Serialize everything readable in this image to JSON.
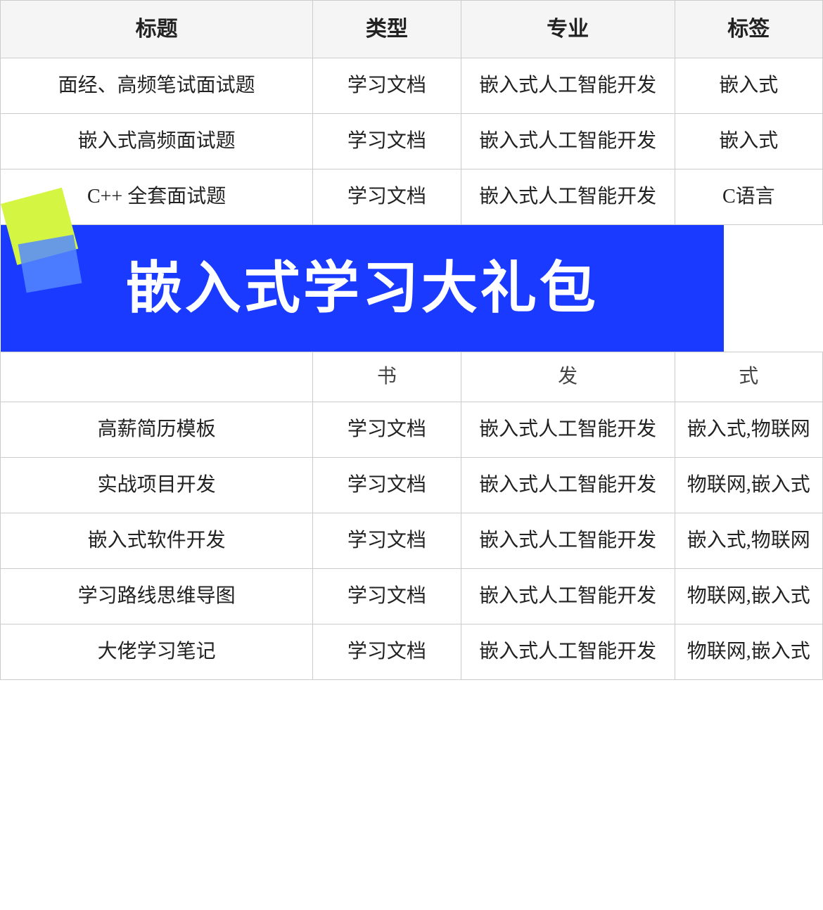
{
  "table": {
    "headers": [
      "标题",
      "类型",
      "专业",
      "标签"
    ],
    "rows": [
      {
        "title": "面经、高频笔试面试题",
        "type": "学习文档",
        "specialty": "嵌入式人工智能开发",
        "tag": "嵌入式"
      },
      {
        "title": "嵌入式高频面试题",
        "type": "学习文档",
        "specialty": "嵌入式人工智能开发",
        "tag": "嵌入式"
      },
      {
        "title": "C++ 全套面试题",
        "type": "学习文档",
        "specialty": "嵌入式人工智能开发",
        "tag": "C语言"
      }
    ],
    "partial_row": {
      "type": "书",
      "specialty": "发",
      "tag": "式"
    },
    "bottom_rows": [
      {
        "title": "高薪简历模板",
        "type": "学习文档",
        "specialty": "嵌入式人工智能开发",
        "tag": "嵌入式,物联网"
      },
      {
        "title": "实战项目开发",
        "type": "学习文档",
        "specialty": "嵌入式人工智能开发",
        "tag": "物联网,嵌入式"
      },
      {
        "title": "嵌入式软件开发",
        "type": "学习文档",
        "specialty": "嵌入式人工智能开发",
        "tag": "嵌入式,物联网"
      },
      {
        "title": "学习路线思维导图",
        "type": "学习文档",
        "specialty": "嵌入式人工智能开发",
        "tag": "物联网,嵌入式"
      },
      {
        "title": "大佬学习笔记",
        "type": "学习文档",
        "specialty": "嵌入式人工智能开发",
        "tag": "物联网,嵌入式"
      }
    ],
    "banner_text": "嵌入式学习大礼包"
  }
}
